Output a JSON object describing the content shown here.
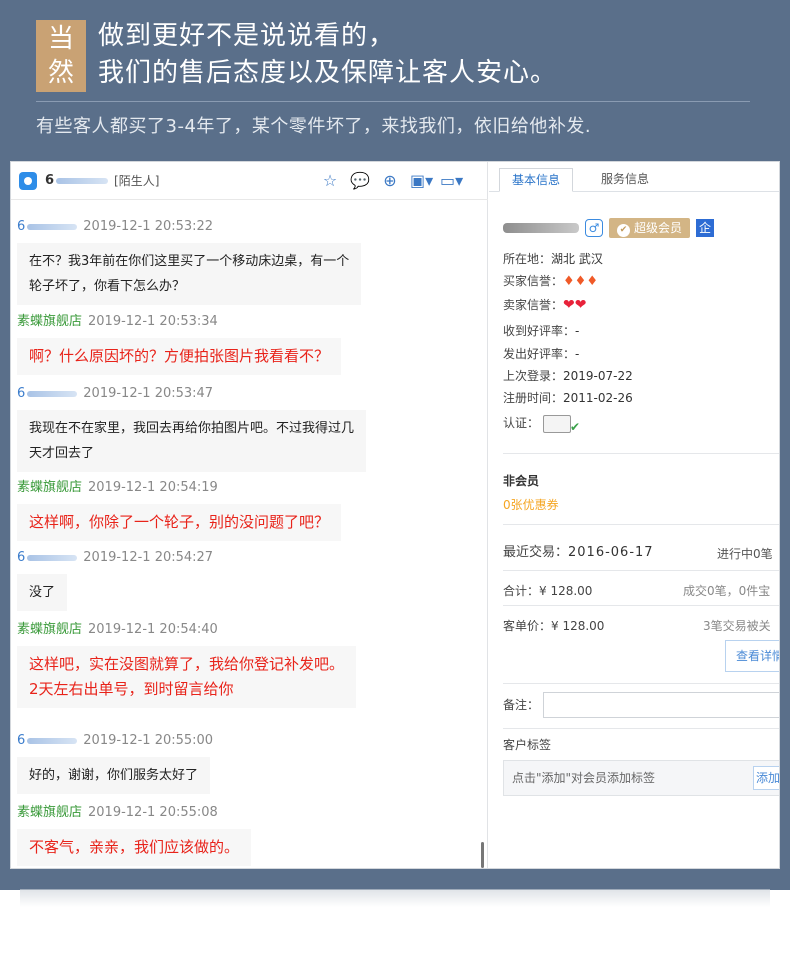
{
  "banner": {
    "badge_top": "当",
    "badge_bottom": "然",
    "headline_line1": "做到更好不是说说看的，",
    "headline_line2": "我们的售后态度以及保障让客人安心。",
    "subline": "有些客人都买了3-4年了，某个零件坏了，来找我们，依旧给他补发."
  },
  "chat": {
    "contact_name_prefix": "6",
    "contact_tag": "[陌生人]",
    "toolbar_icons": [
      "star-person-icon",
      "chat-bubble-icon",
      "add-contact-icon",
      "screenshot-icon",
      "video-call-icon"
    ],
    "messages": [
      {
        "sender": "6",
        "shop": false,
        "time": "2019-12-1 20:53:22",
        "text": "在不？我3年前在你们这里买了一个移动床边桌，有一个\n轮子坏了，你看下怎么办？"
      },
      {
        "sender": "素蝶旗舰店",
        "shop": true,
        "time": "2019-12-1 20:53:34",
        "text": "啊？什么原因坏的？方便拍张图片我看看不？"
      },
      {
        "sender": "6",
        "shop": false,
        "time": "2019-12-1 20:53:47",
        "text": "我现在不在家里，我回去再给你拍图片吧。不过我得过几\n天才回去了"
      },
      {
        "sender": "素蝶旗舰店",
        "shop": true,
        "time": "2019-12-1 20:54:19",
        "text": "这样啊，你除了一个轮子，别的没问题了吧？"
      },
      {
        "sender": "6",
        "shop": false,
        "time": "2019-12-1 20:54:27",
        "text": "没了"
      },
      {
        "sender": "素蝶旗舰店",
        "shop": true,
        "time": "2019-12-1 20:54:40",
        "text": "这样吧，实在没图就算了，我给你登记补发吧。\n2天左右出单号，到时留言给你"
      },
      {
        "sender": "6",
        "shop": false,
        "time": "2019-12-1 20:55:00",
        "text": "好的，谢谢，你们服务太好了"
      },
      {
        "sender": "素蝶旗舰店",
        "shop": true,
        "time": "2019-12-1 20:55:08",
        "text": "不客气，亲亲，我们应该做的。"
      }
    ]
  },
  "info": {
    "tab_basic": "基本信息",
    "tab_service": "服务信息",
    "gender_symbol": "♂",
    "vip_label": "超级会员",
    "ent_label": "企",
    "location_label": "所在地：",
    "location_value": "湖北 武汉",
    "buyer_rep_label": "买家信誉：",
    "buyer_rep_value": "♦♦♦",
    "seller_rep_label": "卖家信誉：",
    "seller_rep_value": "❤❤",
    "good_received_label": "收到好评率：",
    "good_received_value": "-",
    "good_given_label": "发出好评率：",
    "good_given_value": "-",
    "last_login_label": "上次登录：",
    "last_login_value": "2019-07-22",
    "register_label": "注册时间：",
    "register_value": "2011-02-26",
    "cert_label": "认证：",
    "member_status": "非会员",
    "coupon": "0张优惠券",
    "recent_trade_label": "最近交易：",
    "recent_trade_date": "2016-06-17",
    "trade_status": "进行中0笔",
    "total_label": "合计：¥ 128.00",
    "deal_count": "成交0笔，0件宝",
    "unit_price_label": "客单价：¥ 128.00",
    "closed_trades": "3笔交易被关",
    "view_detail": "查看详情",
    "remark_label": "备注：",
    "customer_tag_label": "客户标签",
    "tag_hint": "点击\"添加\"对会员添加标签",
    "add_button": "添加"
  }
}
